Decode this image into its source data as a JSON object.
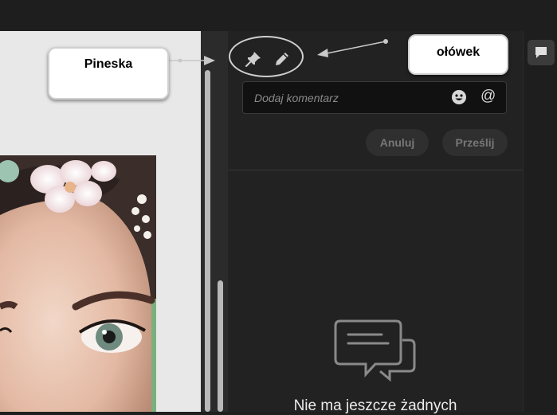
{
  "toolbar": {
    "pin_tool": "pin-icon",
    "pencil_tool": "pencil-icon"
  },
  "comment": {
    "placeholder": "Dodaj komentarz",
    "emoji_icon": "smiley-icon",
    "mention_label": "@"
  },
  "actions": {
    "cancel_label": "Anuluj",
    "submit_label": "Prześlij"
  },
  "empty_state": {
    "icon": "chat-bubbles-icon",
    "text": "Nie ma jeszcze żadnych"
  },
  "annotations": {
    "pin_callout": "Pineska",
    "pencil_callout": "ołówek"
  },
  "sidebar": {
    "comments_icon": "comment-icon"
  }
}
